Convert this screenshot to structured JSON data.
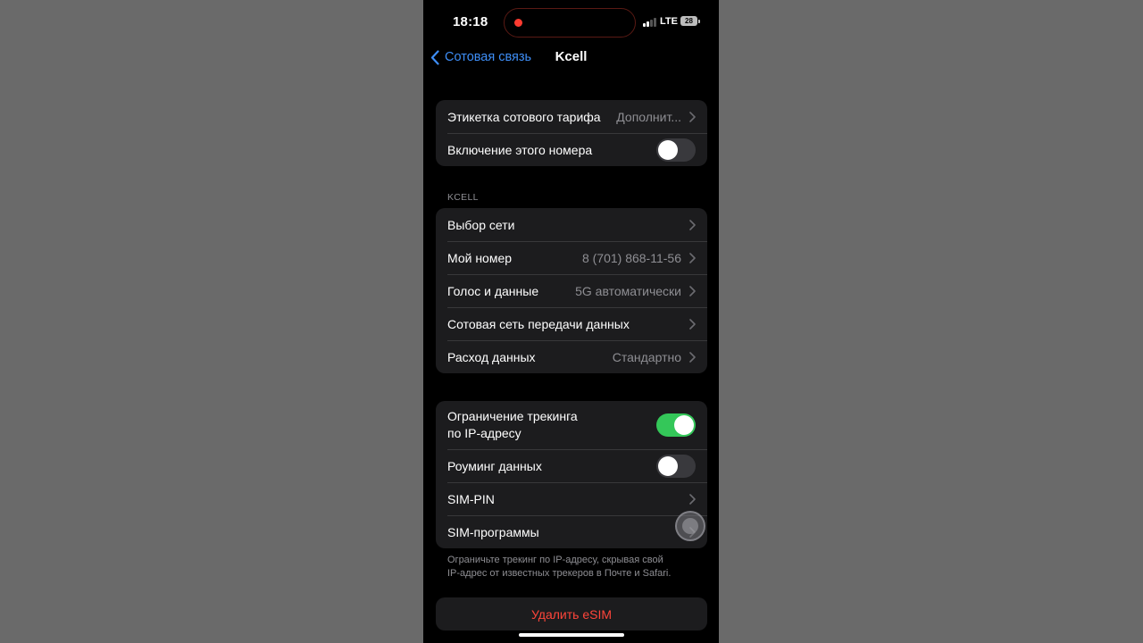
{
  "status_bar": {
    "time": "18:18",
    "network": "LTE",
    "battery": "28"
  },
  "nav": {
    "back_label": "Сотовая связь",
    "title": "Kcell"
  },
  "group1": {
    "plan_label": {
      "label": "Этикетка сотового тарифа",
      "value": "Дополнит..."
    },
    "enable_line": {
      "label": "Включение этого номера",
      "toggle": false
    }
  },
  "section_header": "KCELL",
  "group2": {
    "network_selection": {
      "label": "Выбор сети"
    },
    "my_number": {
      "label": "Мой номер",
      "value": "8 (701) 868-11-56"
    },
    "voice_data": {
      "label": "Голос и данные",
      "value": "5G автоматически"
    },
    "cellular_data_network": {
      "label": "Сотовая сеть передачи данных"
    },
    "data_mode": {
      "label": "Расход данных",
      "value": "Стандартно"
    }
  },
  "group3": {
    "ip_tracking": {
      "label_line1": "Ограничение трекинга",
      "label_line2": "по IP-адресу",
      "toggle": true
    },
    "data_roaming": {
      "label": "Роуминг данных",
      "toggle": false
    },
    "sim_pin": {
      "label": "SIM-PIN"
    },
    "sim_apps": {
      "label": "SIM-программы"
    }
  },
  "footer_line1": "Ограничьте трекинг по IP-адресу, скрывая свой",
  "footer_line2": "IP-адрес от известных трекеров в Почте и Safari.",
  "delete_esim": "Удалить eSIM",
  "colors": {
    "accent": "#3e8ef7",
    "toggle_on": "#34c759",
    "destructive": "#ff453a",
    "recording_dot": "#ff3b30"
  }
}
